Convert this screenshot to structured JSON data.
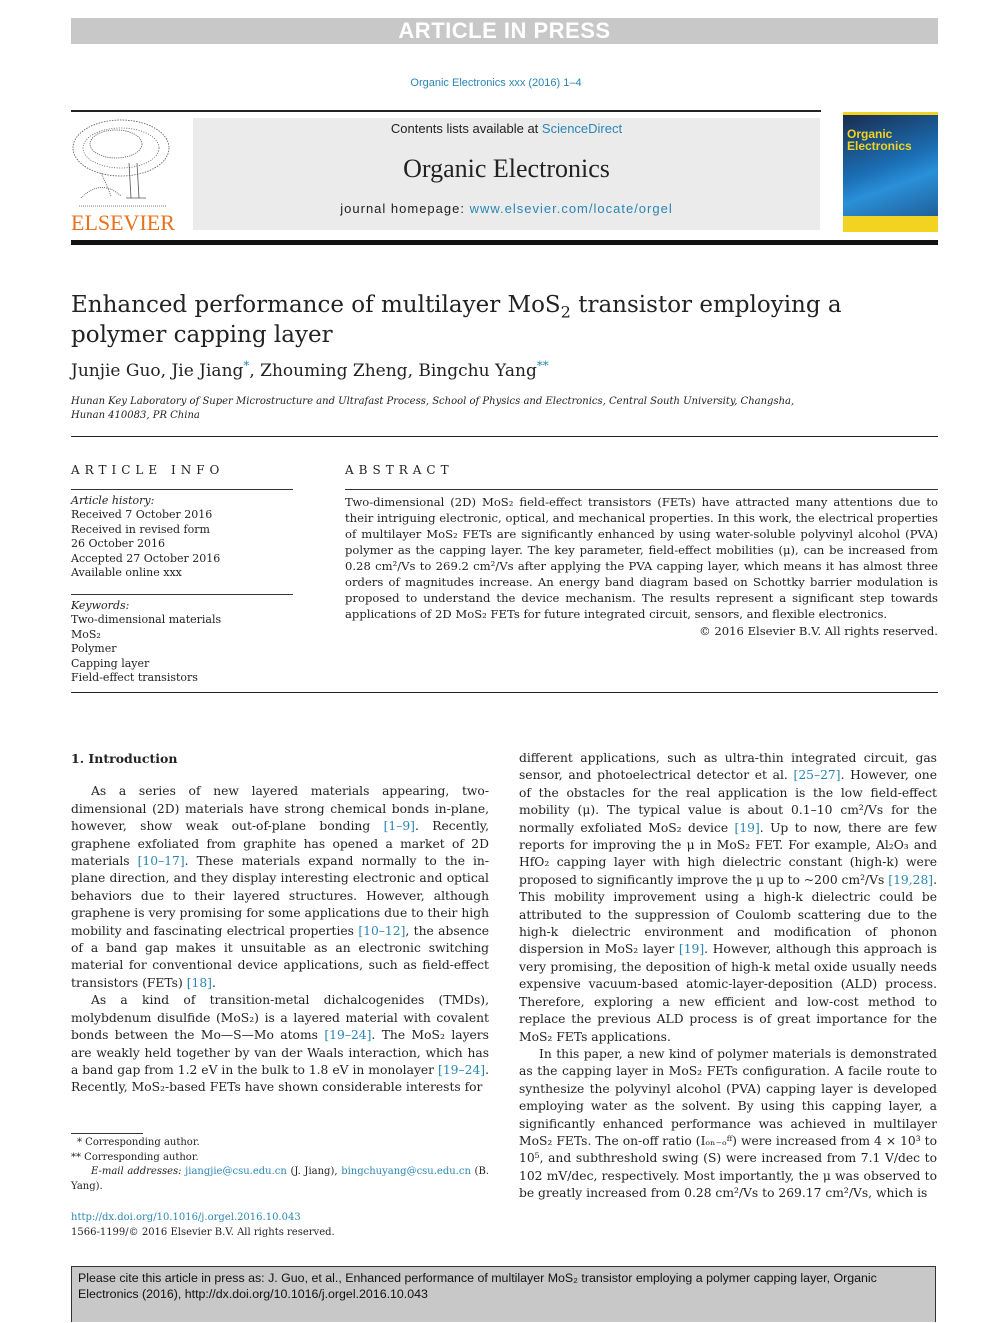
{
  "banner": "ARTICLE IN PRESS",
  "journal_ref": "Organic Electronics xxx (2016) 1–4",
  "publisher_logo_text": "ELSEVIER",
  "masthead": {
    "contents_prefix": "Contents lists available at ",
    "contents_link": "ScienceDirect",
    "journal_name": "Organic Electronics",
    "homepage_prefix": "journal homepage: ",
    "homepage_link": "www.elsevier.com/locate/orgel"
  },
  "cover": {
    "line1": "Organic",
    "line2": "Electronics"
  },
  "article": {
    "title_part1": "Enhanced performance of multilayer MoS",
    "title_sub": "2",
    "title_part2": " transistor employing a polymer capping layer",
    "authors": [
      {
        "name": "Junjie Guo",
        "mark": ""
      },
      {
        "name": "Jie Jiang",
        "mark": "*"
      },
      {
        "name": "Zhouming Zheng",
        "mark": ""
      },
      {
        "name": "Bingchu Yang",
        "mark": "**"
      }
    ],
    "affiliation": "Hunan Key Laboratory of Super Microstructure and Ultrafast Process, School of Physics and Electronics, Central South University, Changsha, Hunan 410083, PR China"
  },
  "article_info": {
    "heading": "ARTICLE INFO",
    "history_label": "Article history:",
    "history": [
      "Received 7 October 2016",
      "Received in revised form",
      "26 October 2016",
      "Accepted 27 October 2016",
      "Available online xxx"
    ],
    "keywords_label": "Keywords:",
    "keywords": [
      "Two-dimensional materials",
      "MoS₂",
      "Polymer",
      "Capping layer",
      "Field-effect transistors"
    ]
  },
  "abstract": {
    "heading": "ABSTRACT",
    "text": "Two-dimensional (2D) MoS₂ field-effect transistors (FETs) have attracted many attentions due to their intriguing electronic, optical, and mechanical properties. In this work, the electrical properties of multilayer MoS₂ FETs are significantly enhanced by using water-soluble polyvinyl alcohol (PVA) polymer as the capping layer. The key parameter, field-effect mobilities (μ), can be increased from 0.28 cm²/Vs to 269.2 cm²/Vs after applying the PVA capping layer, which means it has almost three orders of magnitudes increase. An energy band diagram based on Schottky barrier modulation is proposed to understand the device mechanism. The results represent a significant step towards applications of 2D MoS₂ FETs for future integrated circuit, sensors, and flexible electronics.",
    "copyright": "© 2016 Elsevier B.V. All rights reserved."
  },
  "body": {
    "section_heading": "1.  Introduction",
    "p1": [
      {
        "t": "As a series of new layered materials appearing, two-dimensional (2D) materials have strong chemical bonds in-plane, however, show weak out-of-plane bonding "
      },
      {
        "ref": "[1–9]"
      },
      {
        "t": ". Recently, graphene exfoliated from graphite has opened a market of 2D materials "
      },
      {
        "ref": "[10–17]"
      },
      {
        "t": ". These materials expand normally to the in-plane direction, and they display interesting electronic and optical behaviors due to their layered structures. However, although graphene is very promising for some applications due to their high mobility and fascinating electrical properties "
      },
      {
        "ref": "[10–12]"
      },
      {
        "t": ", the absence of a band gap makes it unsuitable as an electronic switching material for conventional device applications, such as field-effect transistors (FETs) "
      },
      {
        "ref": "[18]"
      },
      {
        "t": "."
      }
    ],
    "p2": [
      {
        "t": "As a kind of transition-metal dichalcogenides (TMDs), molybdenum disulfide (MoS₂) is a layered material with covalent bonds between the Mo—S—Mo atoms "
      },
      {
        "ref": "[19–24]"
      },
      {
        "t": ". The MoS₂ layers are weakly held together by van der Waals interaction, which has a band gap from 1.2 eV in the bulk to 1.8 eV in monolayer "
      },
      {
        "ref": "[19–24]"
      },
      {
        "t": ". Recently, MoS₂-based FETs have shown considerable interests for"
      }
    ],
    "p3": [
      {
        "t": "different applications, such as ultra-thin integrated circuit, gas sensor, and photoelectrical detector et al. "
      },
      {
        "ref": "[25–27]"
      },
      {
        "t": ". However, one of the obstacles for the real application is the low field-effect mobility (μ). The typical value is about 0.1–10 cm²/Vs for the normally exfoliated MoS₂ device "
      },
      {
        "ref": "[19]"
      },
      {
        "t": ". Up to now, there are few reports for improving the μ in MoS₂ FET. For example, Al₂O₃ and HfO₂ capping layer with high dielectric constant (high-k) were proposed to significantly improve the μ up to ~200 cm²/Vs "
      },
      {
        "ref": "[19,28]"
      },
      {
        "t": ". This mobility improvement using a high-k dielectric could be attributed to the suppression of Coulomb scattering due to the high-k dielectric environment and modification of phonon dispersion in MoS₂ layer "
      },
      {
        "ref": "[19]"
      },
      {
        "t": ". However, although this approach is very promising, the deposition of high-k metal oxide usually needs expensive vacuum-based atomic-layer-deposition (ALD) process. Therefore, exploring a new efficient and low-cost method to replace the previous ALD process is of great importance for the MoS₂ FETs applications."
      }
    ],
    "p4": [
      {
        "t": "In this paper, a new kind of polymer materials is demonstrated as the capping layer in MoS₂ FETs configuration. A facile route to synthesize the polyvinyl alcohol (PVA) capping layer is developed employing water as the solvent. By using this capping layer, a significantly enhanced performance was achieved in multilayer MoS₂ FETs. The on-off ratio (Iₒₙ₋ₒᶠᶠ) were increased from 4 × 10³ to 10⁵, and subthreshold swing (S) were increased from 7.1 V/dec to 102 mV/dec, respectively. Most importantly, the μ was observed to be greatly increased from 0.28 cm²/Vs to 269.17 cm²/Vs, which is"
      }
    ]
  },
  "footnotes": {
    "fn1": "*  Corresponding author.",
    "fn2": "**  Corresponding author.",
    "email_label": "E-mail addresses: ",
    "email1": "jiangjie@csu.edu.cn",
    "email1_owner": " (J. Jiang), ",
    "email2": "bingchuyang@csu.edu.cn",
    "email2_owner": " (B. Yang)."
  },
  "doi_link": "http://dx.doi.org/10.1016/j.orgel.2016.10.043",
  "issn_line": "1566-1199/© 2016 Elsevier B.V. All rights reserved.",
  "cite_box": "Please cite this article in press as: J. Guo, et al., Enhanced performance of multilayer MoS₂ transistor employing a polymer capping layer, Organic Electronics (2016), http://dx.doi.org/10.1016/j.orgel.2016.10.043",
  "colors": {
    "link": "#2a86b3",
    "elsevier_orange": "#e9711c",
    "banner_gray": "#c8c8c8"
  }
}
